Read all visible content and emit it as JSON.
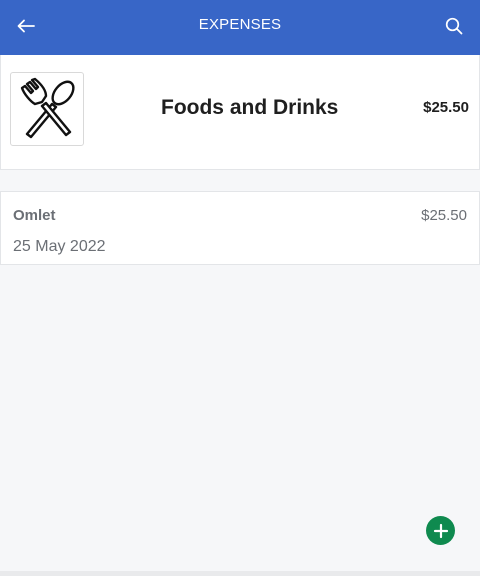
{
  "appbar": {
    "title": "EXPENSES",
    "back_icon": "arrow-left-icon",
    "search_icon": "search-icon",
    "background": "#3866c7"
  },
  "category": {
    "icon": "fork-spoon-icon",
    "name": "Foods and Drinks",
    "total": "$25.50"
  },
  "expenses": [
    {
      "name": "Omlet",
      "amount": "$25.50",
      "date": "25 May 2022"
    }
  ],
  "fab": {
    "icon": "plus-icon",
    "color": "#0f8a4f"
  }
}
